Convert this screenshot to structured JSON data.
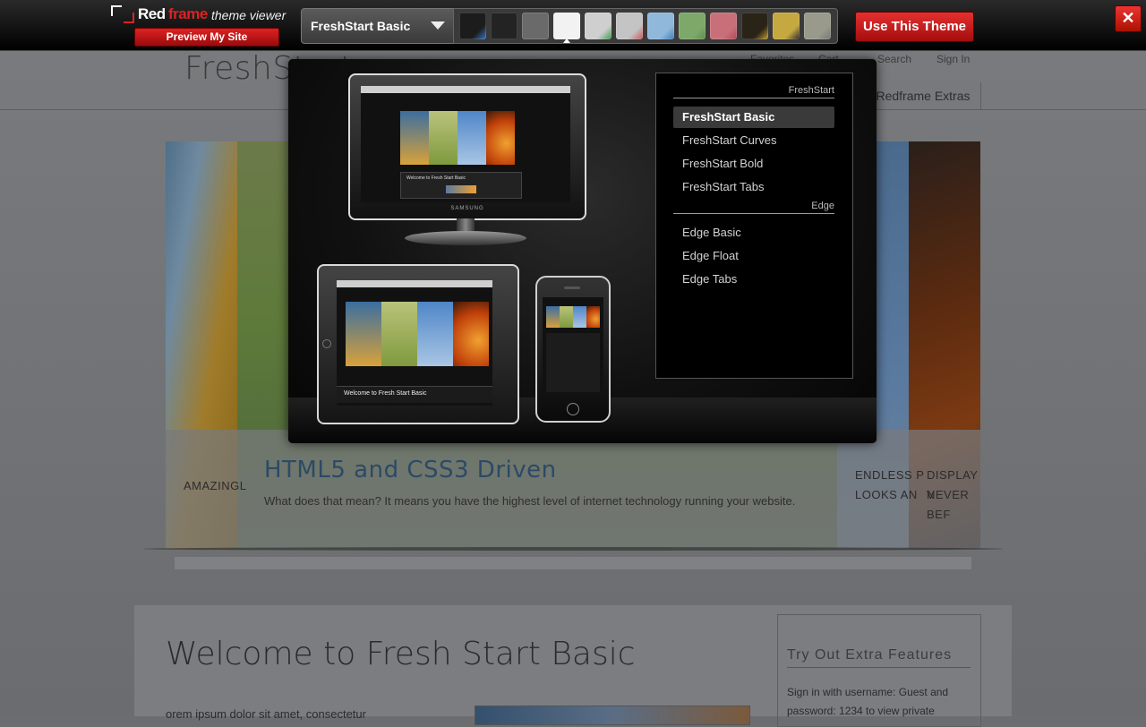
{
  "toolbar": {
    "logo_red": "Red",
    "logo_frame": "frame",
    "logo_subtitle": "theme viewer",
    "preview_label": "Preview My Site",
    "selected_theme": "FreshStart Basic",
    "use_theme_label": "Use This Theme",
    "close_label": "✕",
    "swatches": [
      {
        "name": "dark-blue",
        "color": "#1c1c1c",
        "accent": "#3a78c8"
      },
      {
        "name": "charcoal",
        "color": "#232323",
        "accent": "#232323"
      },
      {
        "name": "glossy-dark",
        "color": "#6a6a6a",
        "accent": "#6a6a6a"
      },
      {
        "name": "white",
        "color": "#f2f2f2",
        "accent": "#f2f2f2"
      },
      {
        "name": "silver-green",
        "color": "#cfcfcf",
        "accent": "#3a9a4a"
      },
      {
        "name": "light-silver",
        "color": "#c4c4c4",
        "accent": "#c55"
      },
      {
        "name": "sky-blue",
        "color": "#8fb8db",
        "accent": "#3c7fc0"
      },
      {
        "name": "green",
        "color": "#7da86a",
        "accent": "#5e8e4e"
      },
      {
        "name": "rose",
        "color": "#c8707a",
        "accent": "#b04a54"
      },
      {
        "name": "black-gold",
        "color": "#2a2418",
        "accent": "#c8a030"
      },
      {
        "name": "gold-stripe",
        "color": "#c6a840",
        "accent": "#2a2a2a"
      },
      {
        "name": "stone",
        "color": "#9a9a8c",
        "accent": "#777"
      }
    ]
  },
  "site": {
    "logo": "FreshStart",
    "util_links": [
      "Favorites",
      "Cart",
      "Search",
      "Sign In"
    ],
    "nav_extra": "Redframe Extras",
    "slide_title": "HTML5 and CSS3 Driven",
    "slide_text": "What does that mean? It means you have the highest level of internet technology running your website.",
    "side_caption_left": "AMAZINGL",
    "side_caption_right_1": "ENDLESS P",
    "side_caption_right_2": "LOOKS AN",
    "side_caption_far_1": "DISPLAY V",
    "side_caption_far_2": "NEVER BEF",
    "welcome_heading": "Welcome to Fresh Start Basic",
    "lorem": "orem ipsum dolor sit amet, consectetur",
    "sidebar_title": "Try Out Extra Features",
    "sidebar_text": "Sign in with username: Guest and password: 1234 to view private"
  },
  "modal": {
    "monitor_brand": "SAMSUNG",
    "tablet_caption": "Welcome to Fresh Start Basic",
    "monitor_caption": "Welcome to Fresh Start Basic",
    "groups": [
      {
        "label": "FreshStart",
        "items": [
          "FreshStart Basic",
          "FreshStart Curves",
          "FreshStart Bold",
          "FreshStart Tabs"
        ]
      },
      {
        "label": "Edge",
        "items": [
          "Edge Basic",
          "Edge Float",
          "Edge Tabs"
        ]
      }
    ],
    "active_item": "FreshStart Basic"
  }
}
